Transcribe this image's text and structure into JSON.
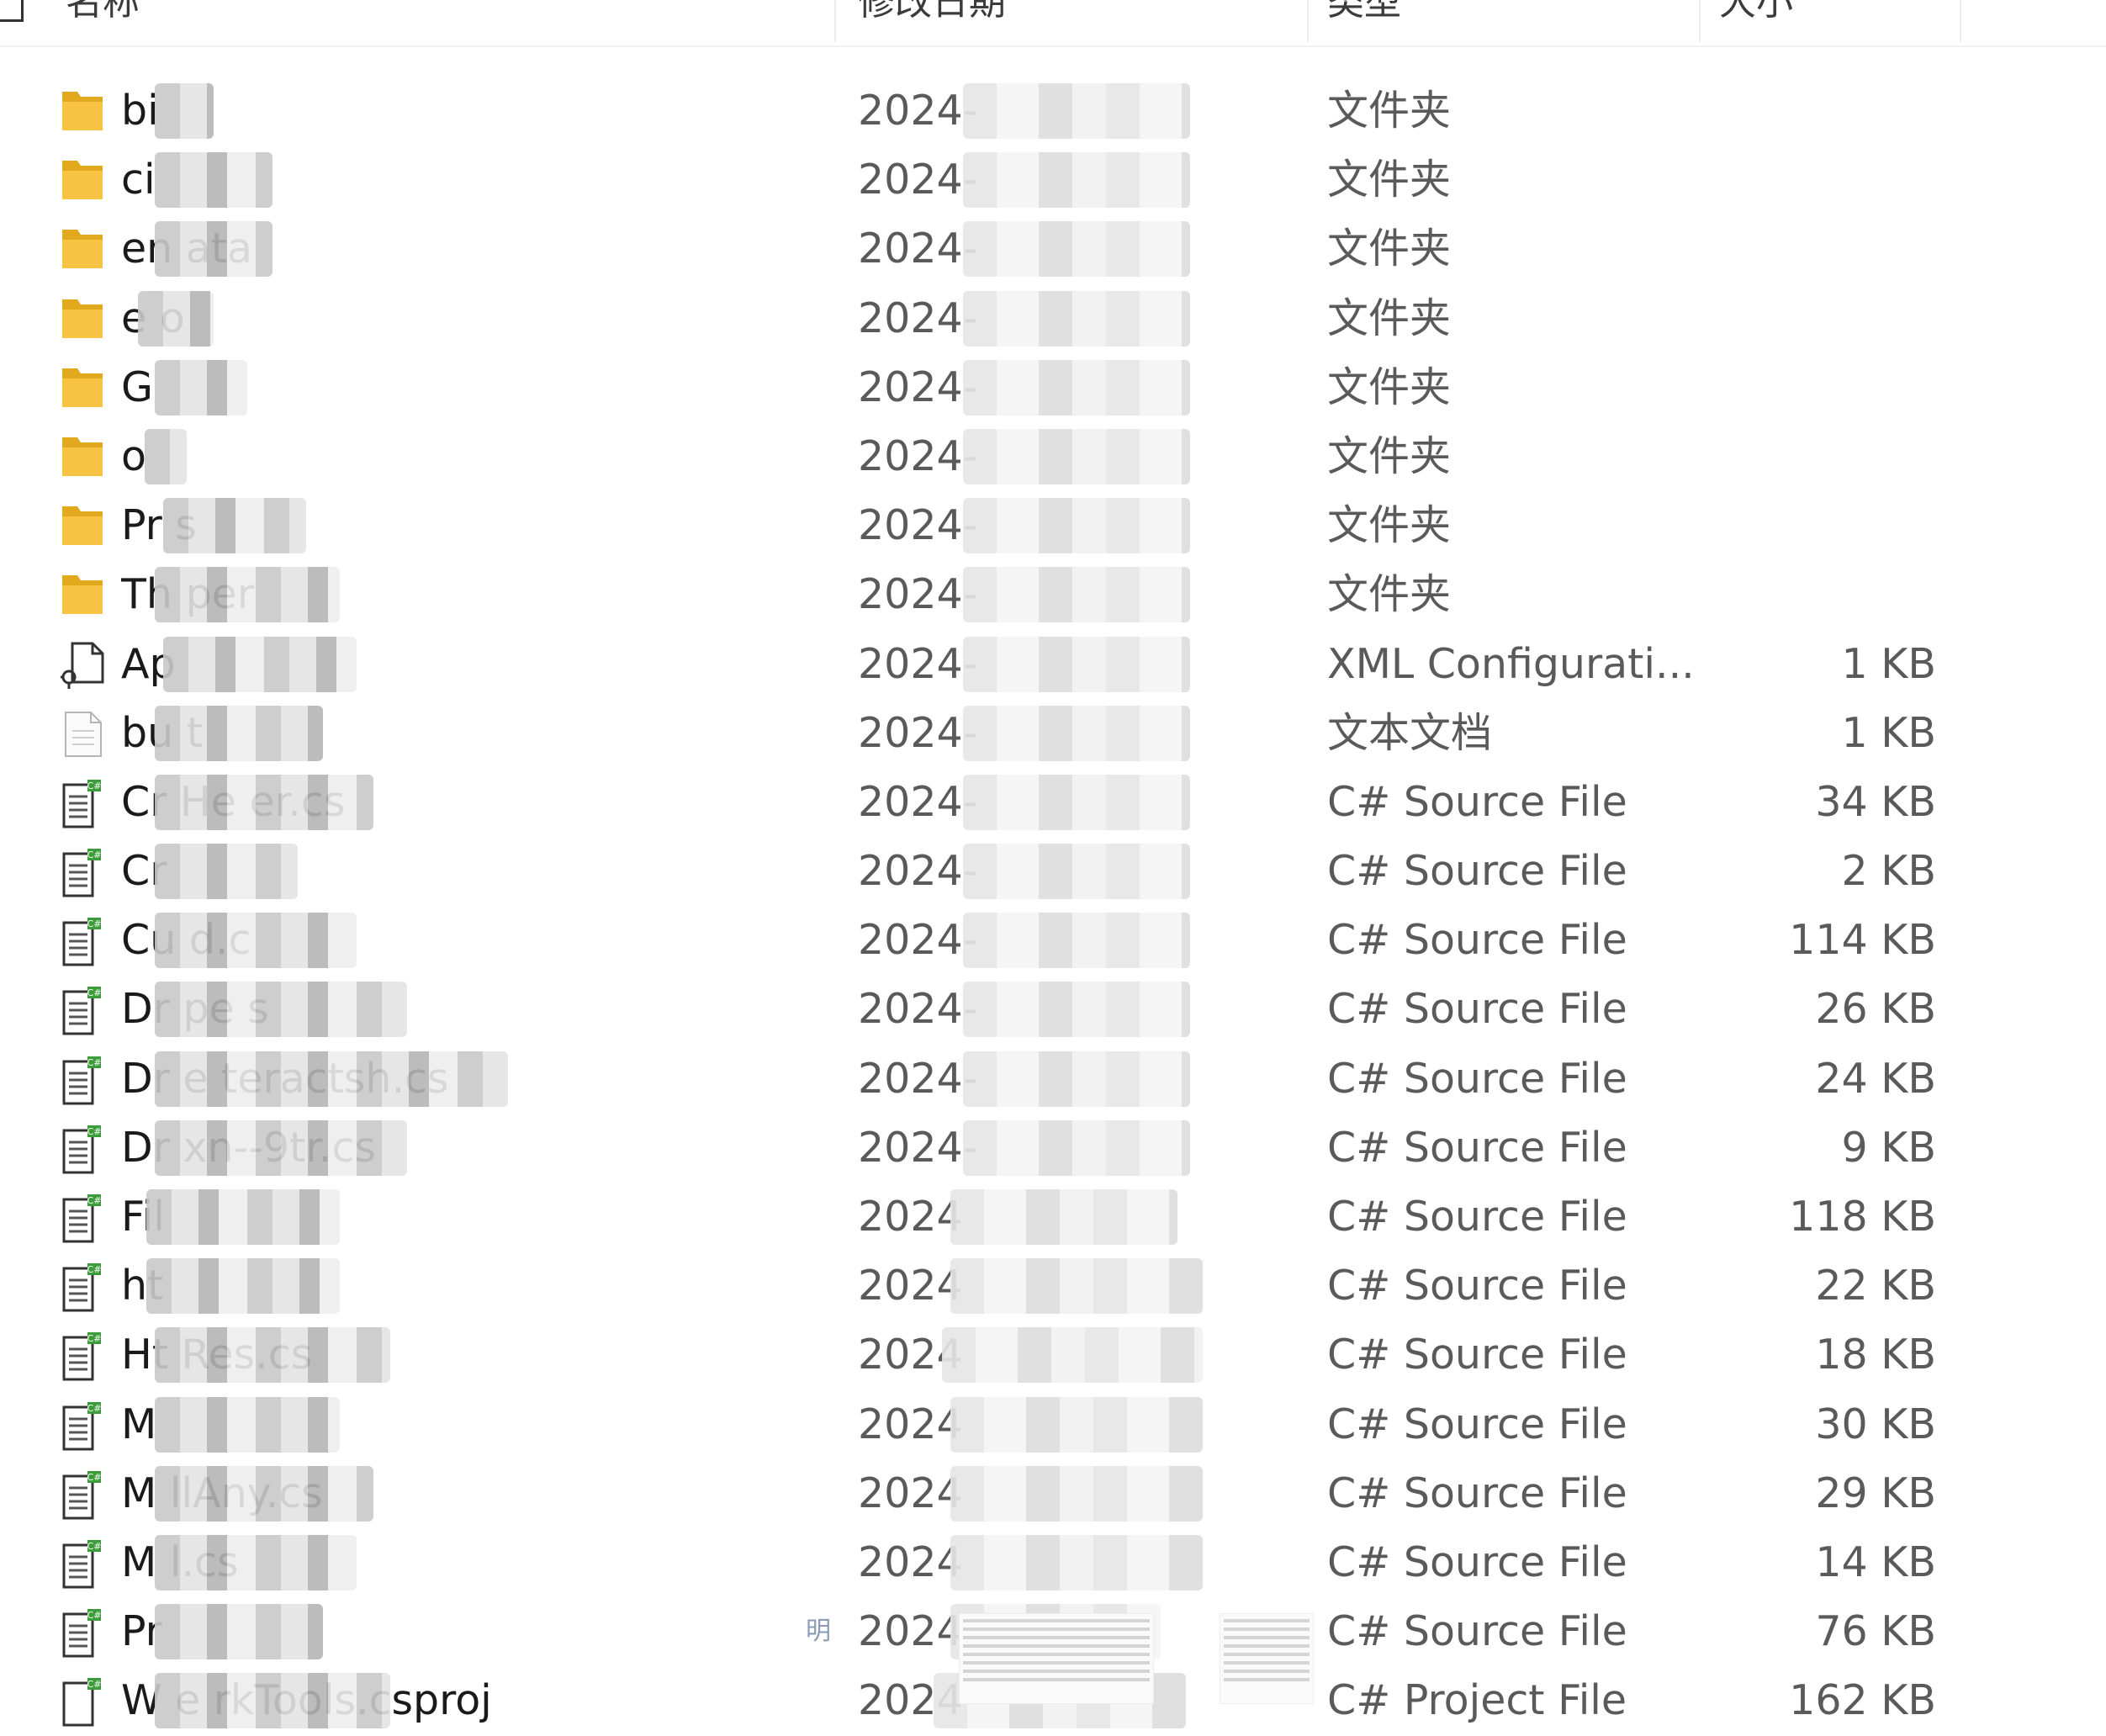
{
  "header": {
    "columns": [
      {
        "label": "名称"
      },
      {
        "label": "修改日期"
      },
      {
        "label": "类型"
      },
      {
        "label": "大小"
      }
    ]
  },
  "rows": [
    {
      "name": "bi",
      "date": "2024-",
      "type": "文件夹",
      "size": "",
      "icon": "folder-icon"
    },
    {
      "name": "ci",
      "date": "2024-",
      "type": "文件夹",
      "size": "",
      "icon": "folder-icon"
    },
    {
      "name": "en          ata",
      "date": "2024-",
      "type": "文件夹",
      "size": "",
      "icon": "folder-icon"
    },
    {
      "name": "e  o",
      "date": "2024-",
      "type": "文件夹",
      "size": "",
      "icon": "folder-icon"
    },
    {
      "name": "G",
      "date": "2024-",
      "type": "文件夹",
      "size": "",
      "icon": "folder-icon"
    },
    {
      "name": "o",
      "date": "2024-",
      "type": "文件夹",
      "size": "",
      "icon": "folder-icon"
    },
    {
      "name": "Pr        s",
      "date": "2024-",
      "type": "文件夹",
      "size": "",
      "icon": "folder-icon"
    },
    {
      "name": "Th           per",
      "date": "2024-",
      "type": "文件夹",
      "size": "",
      "icon": "folder-icon"
    },
    {
      "name": "Ap",
      "date": "2024-",
      "type": "XML Configurati...",
      "size": "1 KB",
      "icon": "xml-config-file-icon"
    },
    {
      "name": "bu           t",
      "date": "2024-",
      "type": "文本文档",
      "size": "1 KB",
      "icon": "text-document-icon"
    },
    {
      "name": "Cr                 He   er.cs",
      "date": "2024-",
      "type": "C# Source File",
      "size": "34 KB",
      "icon": "csharp-file-icon"
    },
    {
      "name": "Cr",
      "date": "2024-",
      "type": "C# Source File",
      "size": "2 KB",
      "icon": "csharp-file-icon"
    },
    {
      "name": "Cu              d.c",
      "date": "2024-",
      "type": "C# Source File",
      "size": "114 KB",
      "icon": "csharp-file-icon"
    },
    {
      "name": "Dr                pe  s",
      "date": "2024-",
      "type": "C# Source File",
      "size": "26 KB",
      "icon": "csharp-file-icon"
    },
    {
      "name": "Dr              e  teractsh.cs",
      "date": "2024-",
      "type": "C# Source File",
      "size": "24 KB",
      "icon": "csharp-file-icon"
    },
    {
      "name": "Dr                 xn--9tr.cs",
      "date": "2024-",
      "type": "C# Source File",
      "size": "9 KB",
      "icon": "csharp-file-icon"
    },
    {
      "name": "Fil",
      "date": "2024",
      "type": "C# Source File",
      "size": "118 KB",
      "icon": "csharp-file-icon"
    },
    {
      "name": "ht",
      "date": "2024",
      "type": "C# Source File",
      "size": "22 KB",
      "icon": "csharp-file-icon"
    },
    {
      "name": "Ht                Res.cs",
      "date": "2024",
      "type": "C# Source File",
      "size": "18 KB",
      "icon": "csharp-file-icon"
    },
    {
      "name": "M",
      "date": "2024",
      "type": "C# Source File",
      "size": "30 KB",
      "icon": "csharp-file-icon"
    },
    {
      "name": "M                llAny.cs",
      "date": "2024",
      "type": "C# Source File",
      "size": "29 KB",
      "icon": "csharp-file-icon"
    },
    {
      "name": "M              l.cs",
      "date": "2024",
      "type": "C# Source File",
      "size": "14 KB",
      "icon": "csharp-file-icon"
    },
    {
      "name": "Pr",
      "date": "2024",
      "type": "C# Source File",
      "size": "76 KB",
      "icon": "csharp-file-icon"
    },
    {
      "name": "W           e    rkTools.csproj",
      "date": "2024",
      "type": "C# Project File",
      "size": "162 KB",
      "icon": "csharp-project-file-icon"
    }
  ],
  "stray_text": "明",
  "colors": {
    "folder": "#f6c342",
    "folder_dark": "#e2a91f",
    "csharp_badge": "#3a9d3a",
    "text_secondary": "#5a5a5a"
  }
}
